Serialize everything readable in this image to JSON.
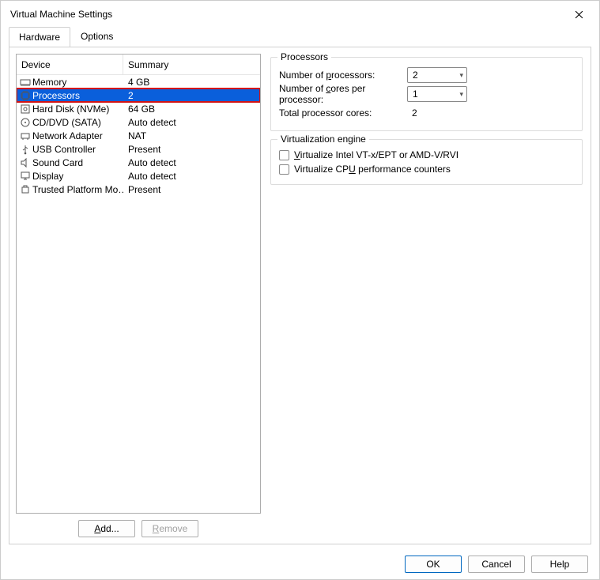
{
  "window": {
    "title": "Virtual Machine Settings"
  },
  "tabs": {
    "hardware": "Hardware",
    "options": "Options"
  },
  "list": {
    "header_device": "Device",
    "header_summary": "Summary",
    "items": [
      {
        "name": "Memory",
        "summary": "4 GB",
        "icon": "memory-icon"
      },
      {
        "name": "Processors",
        "summary": "2",
        "icon": "cpu-icon",
        "selected": true
      },
      {
        "name": "Hard Disk (NVMe)",
        "summary": "64 GB",
        "icon": "disk-icon"
      },
      {
        "name": "CD/DVD (SATA)",
        "summary": "Auto detect",
        "icon": "cd-icon"
      },
      {
        "name": "Network Adapter",
        "summary": "NAT",
        "icon": "network-icon"
      },
      {
        "name": "USB Controller",
        "summary": "Present",
        "icon": "usb-icon"
      },
      {
        "name": "Sound Card",
        "summary": "Auto detect",
        "icon": "sound-icon"
      },
      {
        "name": "Display",
        "summary": "Auto detect",
        "icon": "display-icon"
      },
      {
        "name": "Trusted Platform Mo…",
        "summary": "Present",
        "icon": "tpm-icon"
      }
    ]
  },
  "actions": {
    "add": "Add...",
    "remove": "Remove"
  },
  "processors": {
    "group_title": "Processors",
    "num_processors_label_pre": "Number of ",
    "num_processors_label_u": "p",
    "num_processors_label_post": "rocessors:",
    "num_processors_value": "2",
    "num_cores_label_pre": "Number of ",
    "num_cores_label_u": "c",
    "num_cores_label_post": "ores per processor:",
    "num_cores_value": "1",
    "total_label": "Total processor cores:",
    "total_value": "2"
  },
  "virt": {
    "group_title": "Virtualization engine",
    "opt1_pre": "",
    "opt1_u": "V",
    "opt1_post": "irtualize Intel VT-x/EPT or AMD-V/RVI",
    "opt2_pre": "Virtualize CP",
    "opt2_u": "U",
    "opt2_post": " performance counters"
  },
  "footer": {
    "ok": "OK",
    "cancel": "Cancel",
    "help": "Help"
  }
}
